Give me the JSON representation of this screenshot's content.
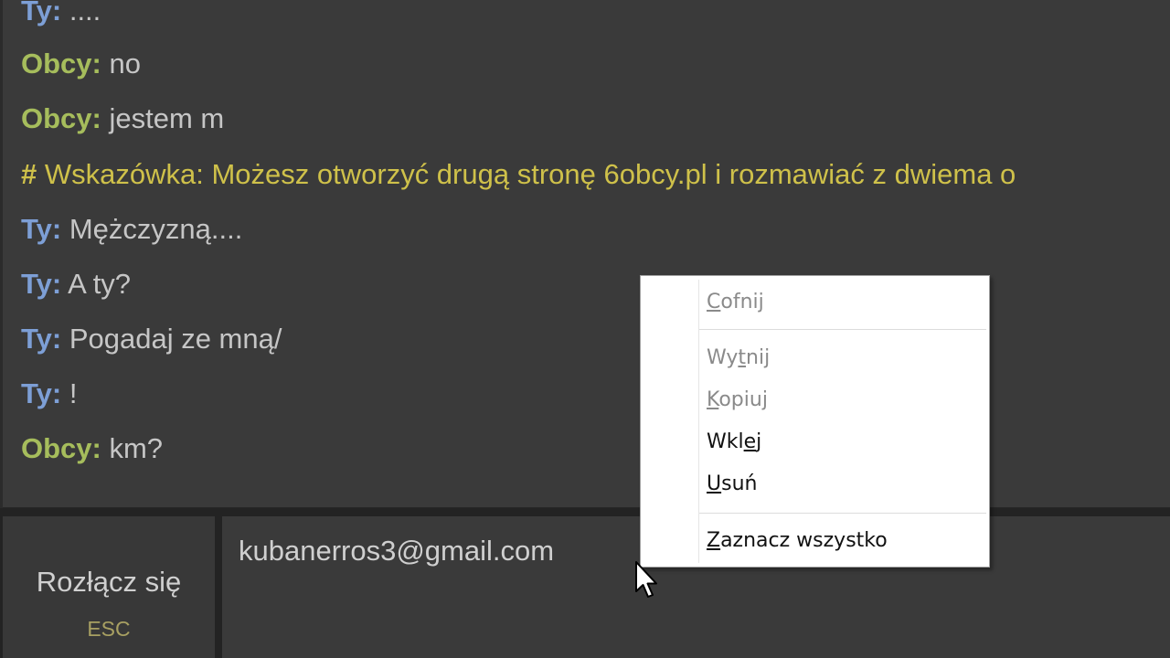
{
  "chat": {
    "messages": [
      {
        "sender": "Ty:",
        "text": "...."
      },
      {
        "sender": "Obcy:",
        "text": "no"
      },
      {
        "sender": "Obcy:",
        "text": "jestem m"
      },
      {
        "sender": "#",
        "text": "Wskazówka: Możesz otworzyć drugą stronę 6obcy.pl i rozmawiać z dwiema o"
      },
      {
        "sender": "Ty:",
        "text": "Mężczyzną...."
      },
      {
        "sender": "Ty:",
        "text": "A ty?"
      },
      {
        "sender": "Ty:",
        "text": "Pogadaj ze mną/"
      },
      {
        "sender": "Ty:",
        "text": "!"
      },
      {
        "sender": "Obcy:",
        "text": "km?"
      }
    ]
  },
  "controls": {
    "disconnect_label": "Rozłącz się",
    "disconnect_shortcut": "ESC",
    "input_value": "kubanerros3@gmail.com"
  },
  "context_menu": {
    "undo": {
      "pre": "",
      "key": "C",
      "post": "ofnij"
    },
    "cut": {
      "pre": "Wy",
      "key": "t",
      "post": "nij"
    },
    "copy": {
      "pre": "",
      "key": "K",
      "post": "opiuj"
    },
    "paste": {
      "pre": "Wkl",
      "key": "e",
      "post": "j"
    },
    "delete": {
      "pre": "",
      "key": "U",
      "post": "suń"
    },
    "select_all": {
      "pre": "",
      "key": "Z",
      "post": "aznacz wszystko"
    }
  },
  "icons": {
    "cursor": "mouse-pointer-icon"
  },
  "colors": {
    "self_name": "#7d9fd6",
    "stranger_name": "#a6bd5c",
    "hint": "#cfc14a",
    "panel": "#3a3a3a"
  }
}
